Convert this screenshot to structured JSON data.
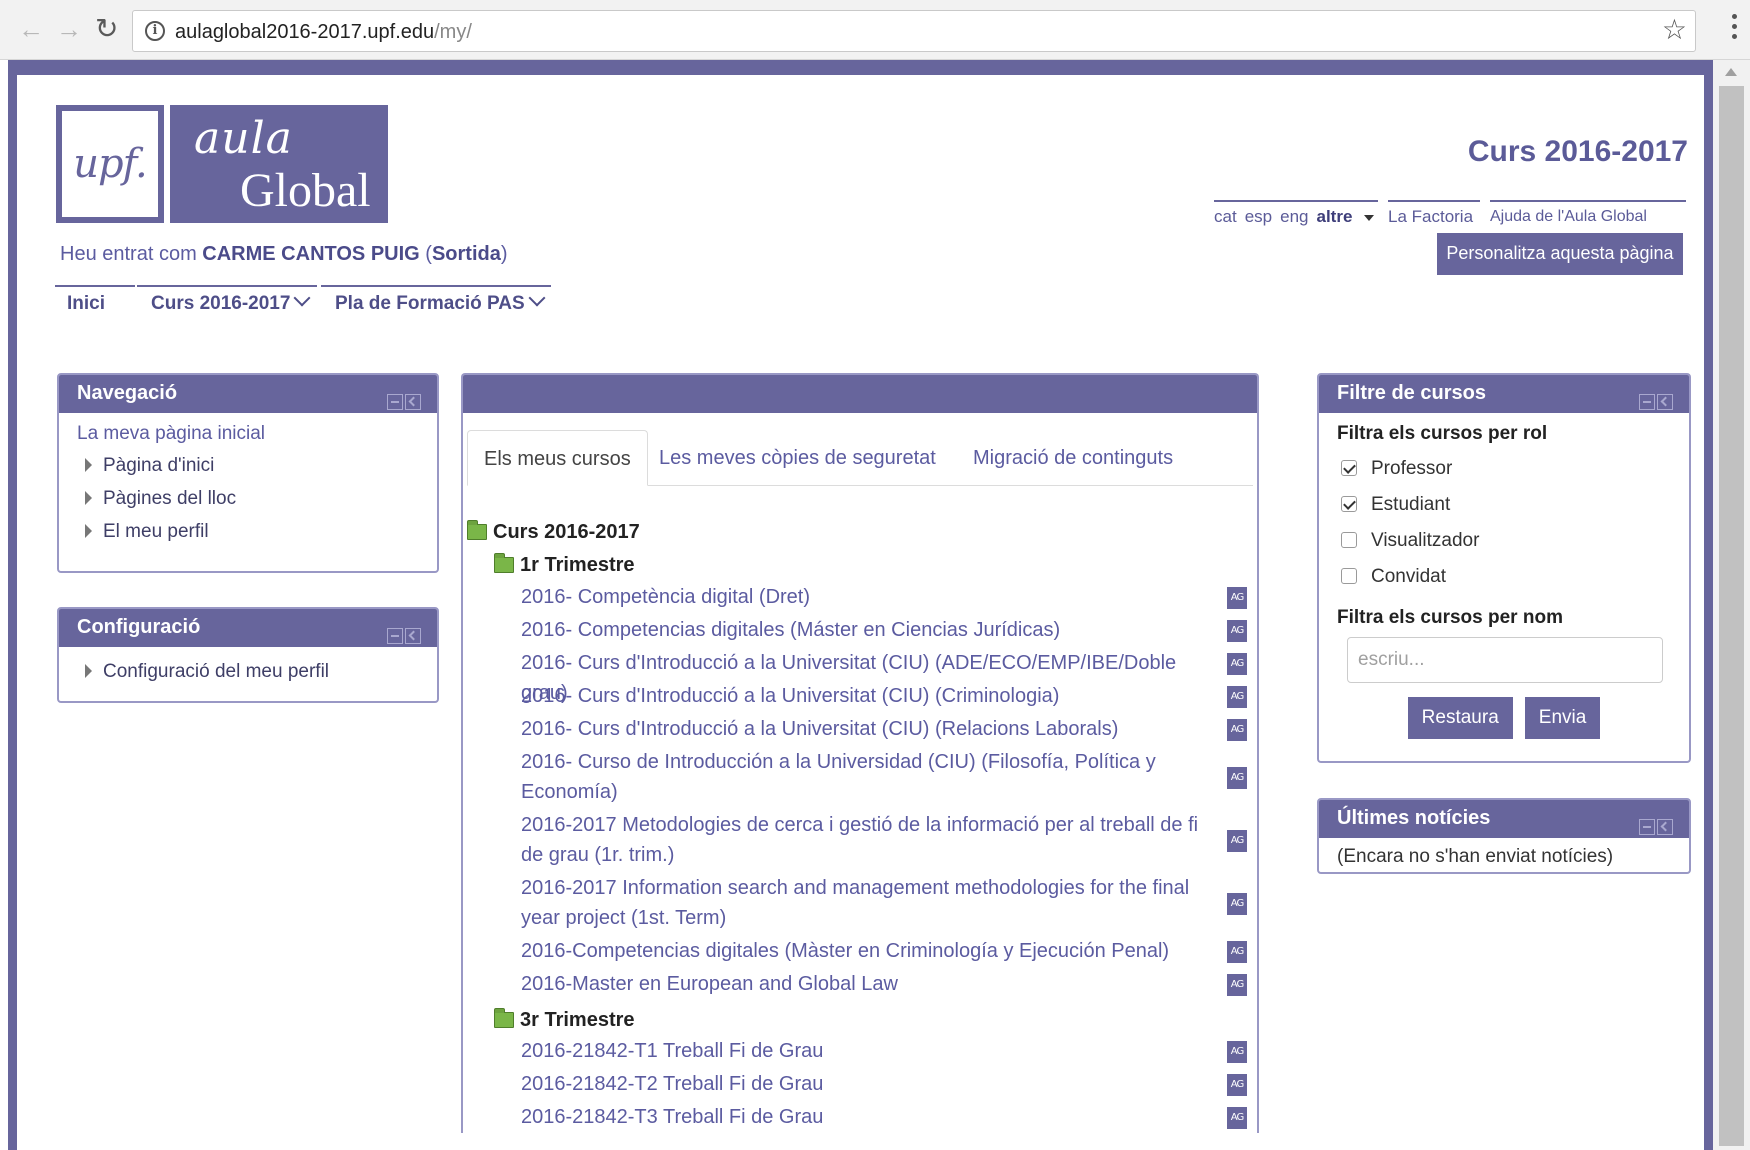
{
  "browser": {
    "url_host": "aulaglobal2016-2017.upf.edu",
    "url_path": "/my/"
  },
  "logo": {
    "left_text": "upf.",
    "script_text": "aula",
    "global_text": "Global"
  },
  "header": {
    "course_title": "Curs 2016-2017",
    "welcome_prefix": "Heu entrat com ",
    "user_name": "CARME CANTOS PUIG",
    "logout_open": " (",
    "logout_label": "Sortida",
    "logout_close": ")",
    "languages": [
      "cat",
      "esp",
      "eng",
      "altre"
    ],
    "factoria_link": "La Factoria",
    "help_link": "Ajuda de l'Aula Global",
    "customize_button": "Personalitza aquesta pàgina"
  },
  "navbar": {
    "items": [
      "Inici",
      "Curs 2016-2017",
      "Pla de Formació PAS"
    ]
  },
  "navigation_block": {
    "title": "Navegació",
    "root": "La meva pàgina inicial",
    "items": [
      "Pàgina d'inici",
      "Pàgines del lloc",
      "El meu perfil"
    ]
  },
  "config_block": {
    "title": "Configuració",
    "items": [
      "Configuració del meu perfil"
    ]
  },
  "main": {
    "tabs": [
      "Els meus cursos",
      "Les meves còpies de seguretat",
      "Migració de continguts"
    ],
    "root_folder": "Curs 2016-2017",
    "folder_1": "1r Trimestre",
    "folder_3": "3r Trimestre",
    "courses_t1": [
      "2016- Competència digital (Dret)",
      "2016- Competencias digitales (Máster en Ciencias Jurídicas)",
      "2016- Curs d'Introducció a la Universitat (CIU) (ADE/ECO/EMP/IBE/Doble grau)",
      "2016- Curs d'Introducció a la Universitat (CIU) (Criminologia)",
      "2016- Curs d'Introducció a la Universitat (CIU) (Relacions Laborals)",
      "2016- Curso de Introducción a la Universidad (CIU) (Filosofía, Política y Economía)",
      "2016-2017 Metodologies de cerca i gestió de la informació per al treball de fi de grau (1r. trim.)",
      "2016-2017 Information search and management methodologies for the final year project (1st. Term)",
      "2016-Competencias digitales (Màster en Criminología y Ejecución Penal)",
      "2016-Master en European and Global Law"
    ],
    "courses_t3": [
      "2016-21842-T1 Treball Fi de Grau",
      "2016-21842-T2 Treball Fi de Grau",
      "2016-21842-T3 Treball Fi de Grau"
    ],
    "course_icon_text": "AG"
  },
  "filter_block": {
    "title": "Filtre de cursos",
    "role_heading": "Filtra els cursos per rol",
    "roles": [
      {
        "label": "Professor",
        "checked": true
      },
      {
        "label": "Estudiant",
        "checked": true
      },
      {
        "label": "Visualitzador",
        "checked": false
      },
      {
        "label": "Convidat",
        "checked": false
      }
    ],
    "name_heading": "Filtra els cursos per nom",
    "name_placeholder": "escriu...",
    "reset_button": "Restaura",
    "send_button": "Envia"
  },
  "news_block": {
    "title": "Últimes notícies",
    "empty_text": "(Encara no s'han enviat notícies)"
  },
  "colors": {
    "brand": "#67659c",
    "link": "#5b5ba0",
    "folder": "#7ab648"
  }
}
